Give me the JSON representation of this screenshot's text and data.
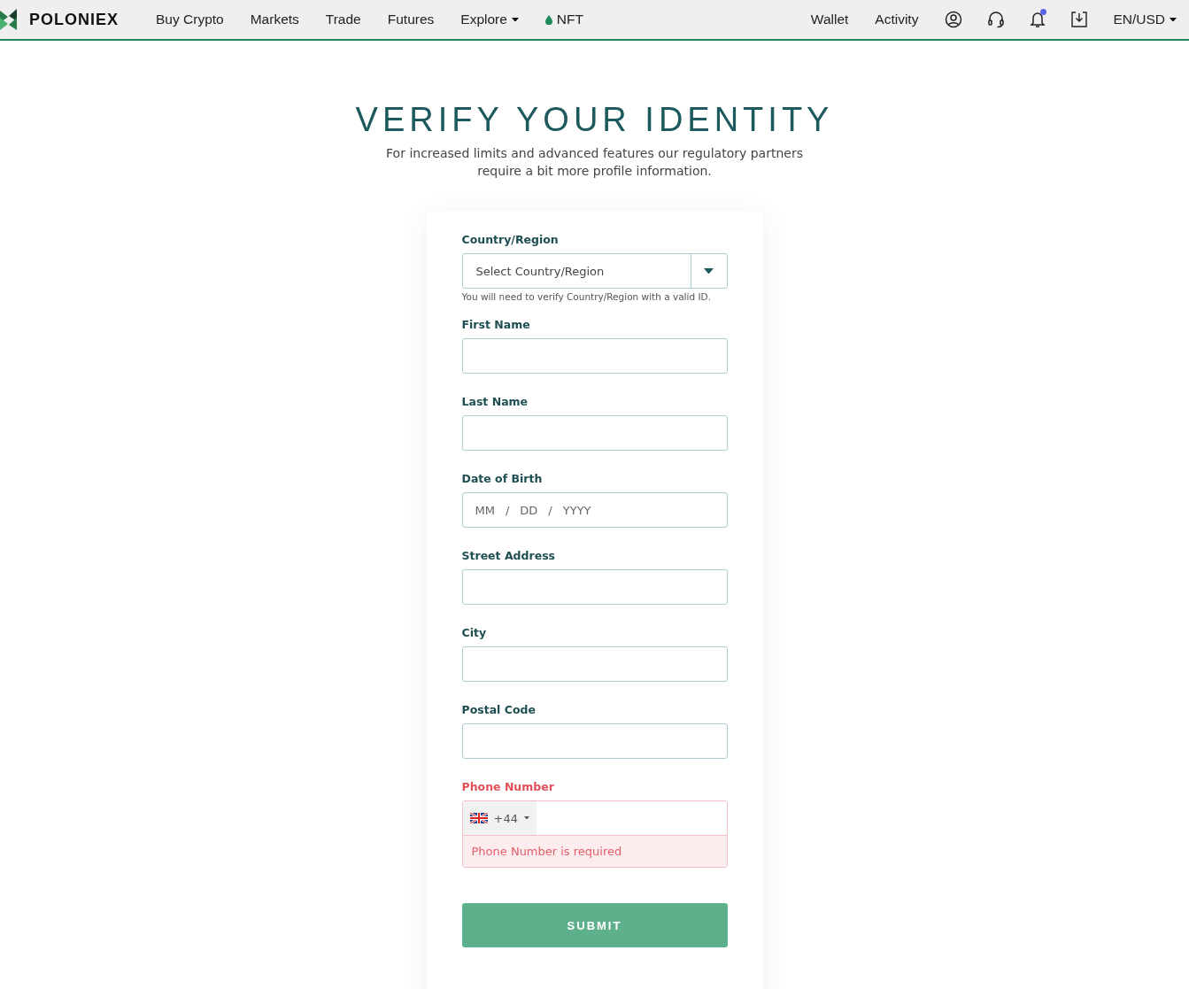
{
  "header": {
    "brand": "POLONIEX",
    "nav": [
      {
        "label": "Buy Crypto",
        "kind": "link"
      },
      {
        "label": "Markets",
        "kind": "link"
      },
      {
        "label": "Trade",
        "kind": "link"
      },
      {
        "label": "Futures",
        "kind": "link"
      },
      {
        "label": "Explore",
        "kind": "dropdown"
      },
      {
        "label": "NFT",
        "kind": "nft"
      }
    ],
    "right_links": [
      "Wallet",
      "Activity"
    ],
    "notifications": {
      "unread": true
    },
    "locale": "EN/USD"
  },
  "title": "VERIFY YOUR IDENTITY",
  "subtitle": "For increased limits and advanced features our regulatory partners require a bit more profile information.",
  "form": {
    "fields": [
      {
        "kind": "select",
        "label": "Country/Region",
        "placeholder": "Select Country/Region",
        "hint": "You will need to verify Country/Region with a valid ID.",
        "error": false
      },
      {
        "kind": "text",
        "label": "First Name",
        "error": false
      },
      {
        "kind": "text",
        "label": "Last Name",
        "error": false
      },
      {
        "kind": "date",
        "label": "Date of Birth",
        "parts": [
          "MM",
          "/",
          "DD",
          "/",
          "YYYY"
        ],
        "error": false
      },
      {
        "kind": "text",
        "label": "Street Address",
        "error": false
      },
      {
        "kind": "text",
        "label": "City",
        "error": false
      },
      {
        "kind": "text",
        "label": "Postal Code",
        "error": false
      },
      {
        "kind": "phone",
        "label": "Phone Number",
        "dial_code": "+44",
        "error": true,
        "error_message": "Phone Number is required"
      }
    ],
    "submit": "SUBMIT"
  }
}
